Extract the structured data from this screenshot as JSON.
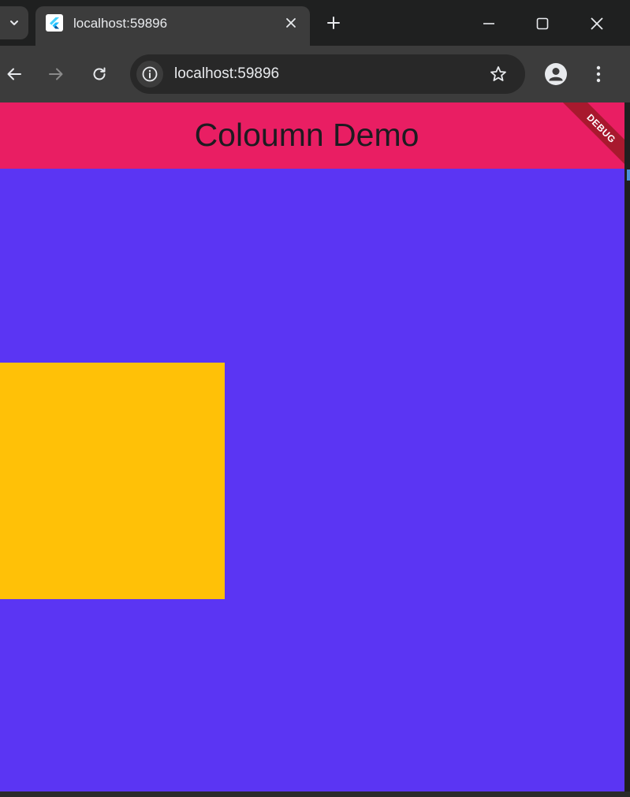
{
  "browser": {
    "tab": {
      "title": "localhost:59896",
      "favicon": "flutter-icon"
    },
    "omnibox": {
      "url": "localhost:59896"
    },
    "icons": {
      "tab_search": "chevron-down-icon",
      "tab_close": "close-icon",
      "new_tab": "plus-icon",
      "minimize": "minimize-icon",
      "maximize": "maximize-icon",
      "close": "close-icon",
      "back": "arrow-left-icon",
      "forward": "arrow-right-icon",
      "reload": "reload-icon",
      "site_info": "info-icon",
      "bookmark": "star-icon",
      "profile": "person-icon",
      "menu": "kebab-menu-icon"
    }
  },
  "app": {
    "appbar_title": "Coloumn Demo",
    "debug_banner": "DEBUG",
    "colors": {
      "appbar": "#e91e63",
      "background": "#5b35f3",
      "box": "#ffc107",
      "debug_banner": "#a8192e"
    }
  }
}
